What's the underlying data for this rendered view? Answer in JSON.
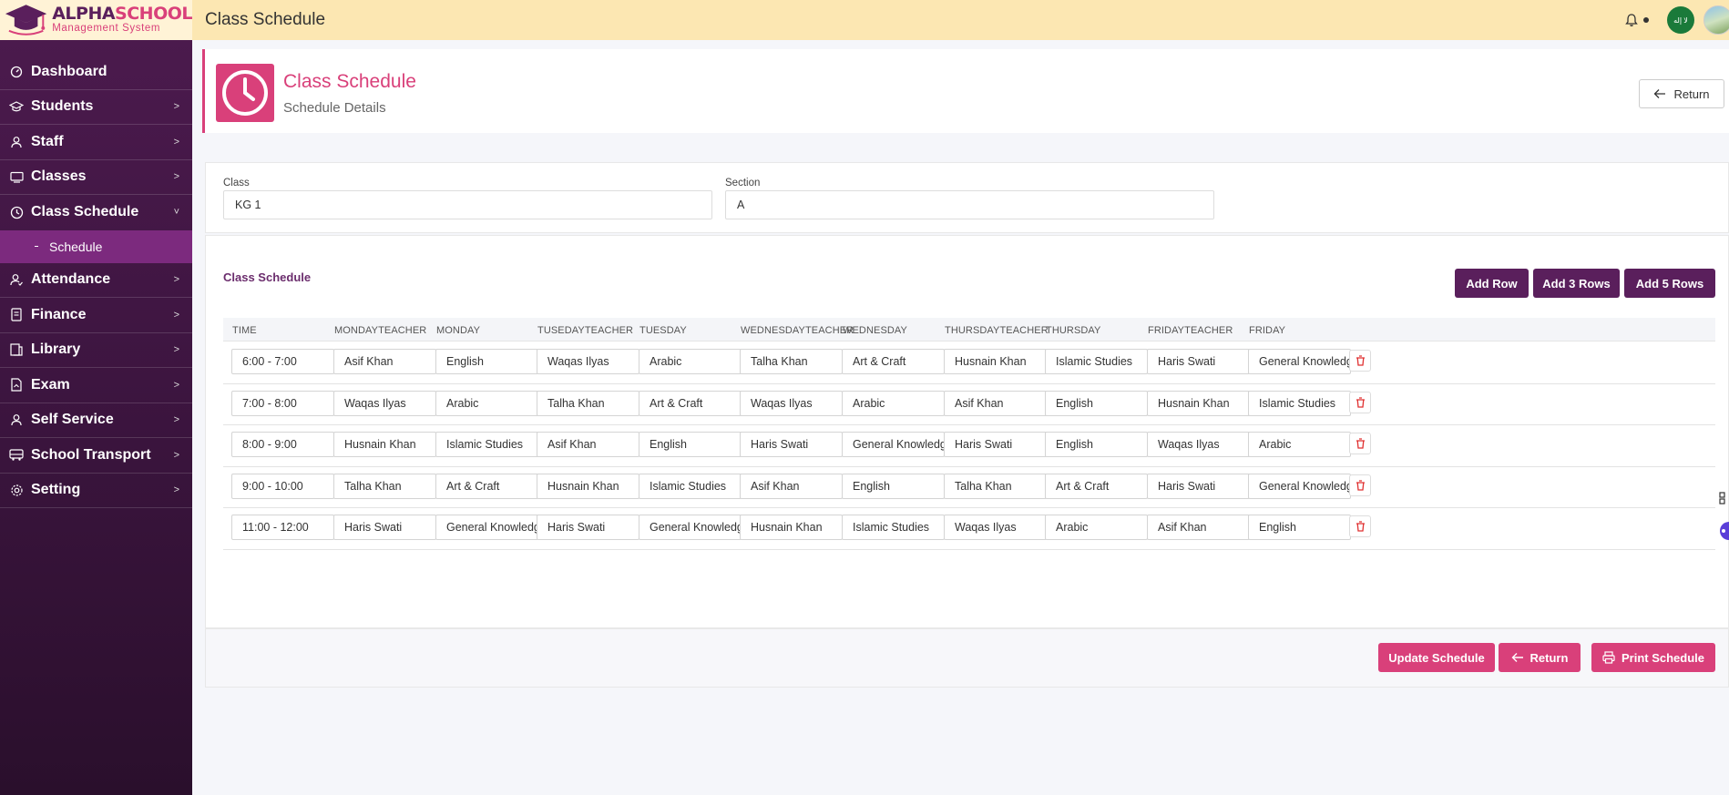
{
  "brand": {
    "title_part1": "ALPHA",
    "title_part2": "SCHOOL",
    "subtitle": "Management System"
  },
  "topbar": {
    "title": "Class Schedule",
    "flag_text": "لا إله"
  },
  "sidebar": {
    "items": [
      {
        "label": "Dashboard",
        "icon": "dashboard-icon",
        "has_chevron": false
      },
      {
        "label": "Students",
        "icon": "graduation-cap-icon",
        "has_chevron": true
      },
      {
        "label": "Staff",
        "icon": "user-icon",
        "has_chevron": true
      },
      {
        "label": "Classes",
        "icon": "chalkboard-icon",
        "has_chevron": true
      },
      {
        "label": "Class Schedule",
        "icon": "clock-icon",
        "has_chevron": true,
        "expanded": true
      },
      {
        "label": "Attendance",
        "icon": "user-check-icon",
        "has_chevron": true
      },
      {
        "label": "Finance",
        "icon": "receipt-icon",
        "has_chevron": true
      },
      {
        "label": "Library",
        "icon": "book-icon",
        "has_chevron": true
      },
      {
        "label": "Exam",
        "icon": "document-icon",
        "has_chevron": true
      },
      {
        "label": "Self Service",
        "icon": "person-icon",
        "has_chevron": true
      },
      {
        "label": "School Transport",
        "icon": "bus-icon",
        "has_chevron": true
      },
      {
        "label": "Setting",
        "icon": "gear-icon",
        "has_chevron": true
      }
    ],
    "sub_item": "Schedule",
    "chevron_right": ">",
    "chevron_down": "˅"
  },
  "header": {
    "title": "Class Schedule",
    "subtitle": "Schedule Details",
    "return_label": "Return"
  },
  "filters": {
    "class_label": "Class",
    "class_value": "KG 1",
    "section_label": "Section",
    "section_value": "A"
  },
  "schedule": {
    "title": "Class Schedule",
    "add_row": "Add Row",
    "add_3_rows": "Add 3 Rows",
    "add_5_rows": "Add 5 Rows",
    "columns": [
      "TIME",
      "MONDAYTEACHER",
      "MONDAY",
      "TUSEDAYTEACHER",
      "TUESDAY",
      "WEDNESDAYTEACHER",
      "WEDNESDAY",
      "THURSDAYTEACHER",
      "THURSDAY",
      "FRIDAYTEACHER",
      "FRIDAY"
    ],
    "rows": [
      [
        "6:00 - 7:00",
        "Asif Khan",
        "English",
        "Waqas Ilyas",
        "Arabic",
        "Talha Khan",
        "Art & Craft",
        "Husnain Khan",
        "Islamic Studies",
        "Haris Swati",
        "General Knowledge"
      ],
      [
        "7:00 - 8:00",
        "Waqas Ilyas",
        "Arabic",
        "Talha Khan",
        "Art & Craft",
        "Waqas Ilyas",
        "Arabic",
        "Asif Khan",
        "English",
        "Husnain Khan",
        "Islamic Studies"
      ],
      [
        "8:00 - 9:00",
        "Husnain Khan",
        "Islamic Studies",
        "Asif Khan",
        "English",
        "Haris Swati",
        "General Knowledge",
        "Haris Swati",
        "English",
        "Waqas Ilyas",
        "Arabic"
      ],
      [
        "9:00 - 10:00",
        "Talha Khan",
        "Art & Craft",
        "Husnain Khan",
        "Islamic Studies",
        "Asif Khan",
        "English",
        "Talha Khan",
        "Art & Craft",
        "Haris Swati",
        "General Knowledge"
      ],
      [
        "11:00 - 12:00",
        "Haris Swati",
        "General Knowledge",
        "Haris Swati",
        "General Knowledge",
        "Husnain Khan",
        "Islamic Studies",
        "Waqas Ilyas",
        "Arabic",
        "Asif Khan",
        "English"
      ]
    ]
  },
  "footer": {
    "update_label": "Update Schedule",
    "return_label": "Return",
    "print_label": "Print Schedule"
  },
  "colors": {
    "primary": "#d9407a",
    "secondary": "#5a1f5c",
    "sidebar_active": "#7c2a7e",
    "topbar": "#fce7b2"
  }
}
